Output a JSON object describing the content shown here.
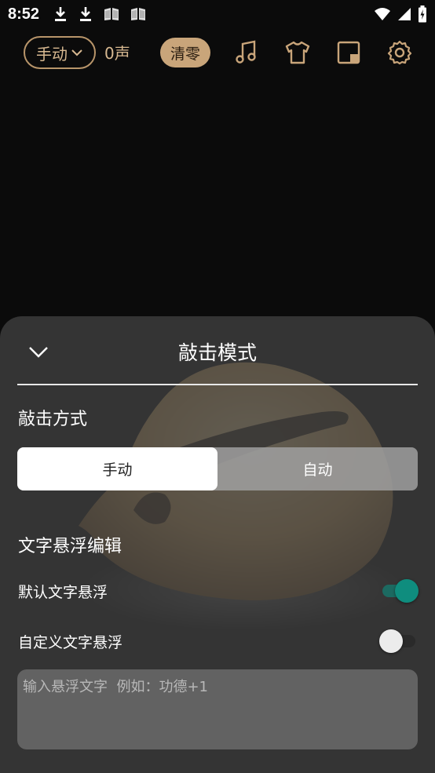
{
  "status_bar": {
    "time": "8:52",
    "left_icons": [
      "download-icon",
      "download-icon",
      "book-icon",
      "book-icon"
    ],
    "right_icons": [
      "wifi-icon",
      "signal-icon",
      "battery-charging-icon"
    ]
  },
  "toolbar": {
    "mode_label": "手动",
    "count_text": "0声",
    "clear_label": "清零",
    "icons": [
      "music-note-icon",
      "tshirt-icon",
      "window-icon",
      "gear-icon"
    ],
    "accent_color": "#c9a57a"
  },
  "sheet": {
    "title": "敲击模式",
    "knock_method_title": "敲击方式",
    "segment_options": [
      "手动",
      "自动"
    ],
    "selected_segment": "手动",
    "float_edit_title": "文字悬浮编辑",
    "default_float_label": "默认文字悬浮",
    "default_float_on": true,
    "custom_float_label": "自定义文字悬浮",
    "custom_float_on": false,
    "input_placeholder": "输入悬浮文字  例如：功德+1",
    "input_value": "",
    "toggle_on_color": "#0f8d7e"
  }
}
